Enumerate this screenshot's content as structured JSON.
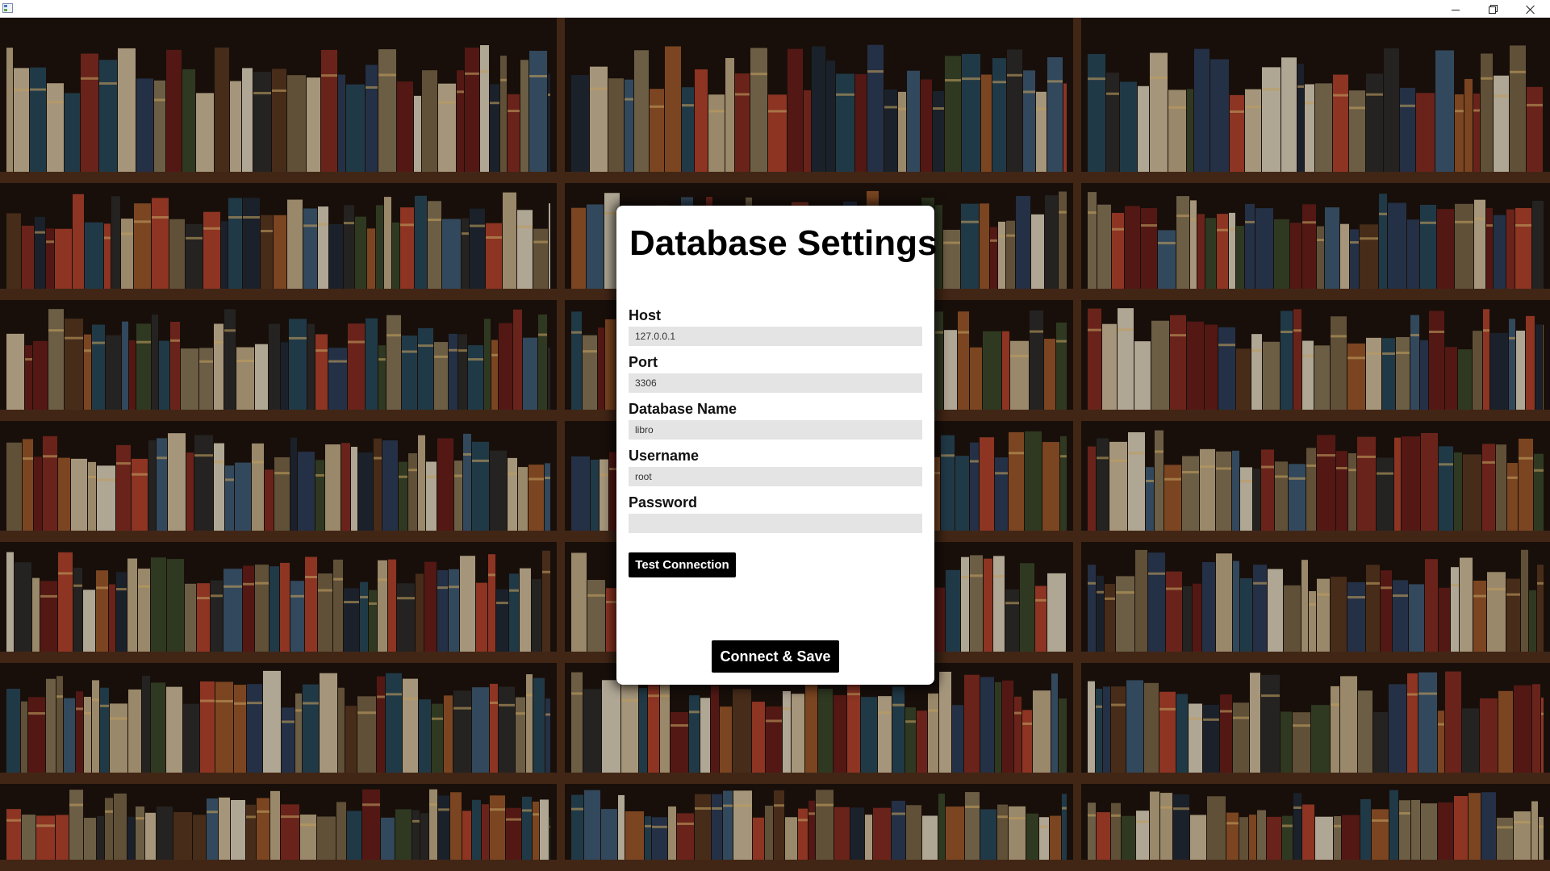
{
  "window": {
    "icon": "app-window-icon",
    "controls": {
      "minimize": "minimize-icon",
      "maximize": "restore-icon",
      "close": "close-icon"
    }
  },
  "background": {
    "description_icon": "bookshelf-background",
    "shelf_color": "#4a2c1a",
    "dark_color": "#1c120c"
  },
  "dialog": {
    "title": "Database Settings",
    "fields": [
      {
        "label": "Host",
        "value": "127.0.0.1",
        "placeholder": ""
      },
      {
        "label": "Port",
        "value": "3306",
        "placeholder": ""
      },
      {
        "label": "Database Name",
        "value": "libro",
        "placeholder": ""
      },
      {
        "label": "Username",
        "value": "root",
        "placeholder": ""
      },
      {
        "label": "Password",
        "value": "",
        "placeholder": ""
      }
    ],
    "test_button": "Test Connection",
    "save_button": "Connect & Save"
  },
  "colors": {
    "dialog_bg": "#ffffff",
    "input_bg": "#e4e4e4",
    "button_bg": "#000000",
    "button_text": "#ffffff"
  }
}
